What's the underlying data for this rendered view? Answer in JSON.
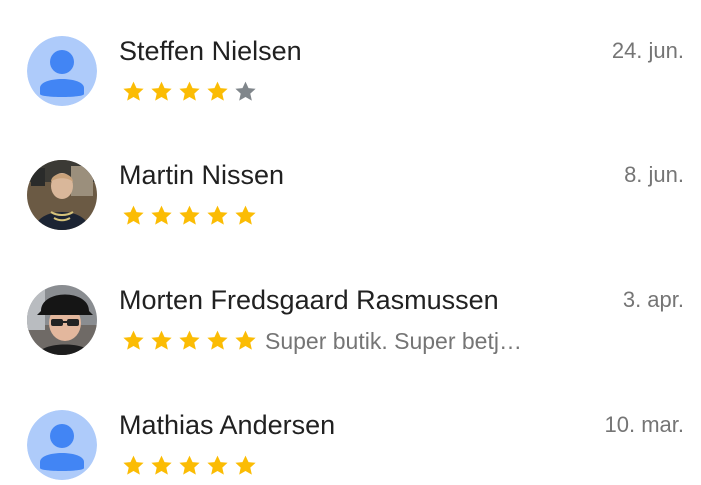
{
  "reviews": [
    {
      "name": "Steffen Nielsen",
      "date": "24. jun.",
      "rating": 4,
      "max_rating": 5,
      "snippet": "",
      "avatar": "default-person-icon"
    },
    {
      "name": "Martin Nissen",
      "date": "8. jun.",
      "rating": 5,
      "max_rating": 5,
      "snippet": "",
      "avatar": "profile-photo"
    },
    {
      "name": "Morten Fredsgaard Rasmussen",
      "date": "3. apr.",
      "rating": 5,
      "max_rating": 5,
      "snippet": "Super butik. Super  betj…",
      "avatar": "profile-photo"
    },
    {
      "name": "Mathias Andersen",
      "date": "10. mar.",
      "rating": 5,
      "max_rating": 5,
      "snippet": "",
      "avatar": "default-person-icon"
    }
  ],
  "colors": {
    "star_filled": "#FBBC04",
    "star_empty": "#80868B",
    "default_avatar_bg": "#AECBFA",
    "default_avatar_fg": "#4285F4",
    "name_text": "#212121",
    "secondary_text": "#757575"
  }
}
